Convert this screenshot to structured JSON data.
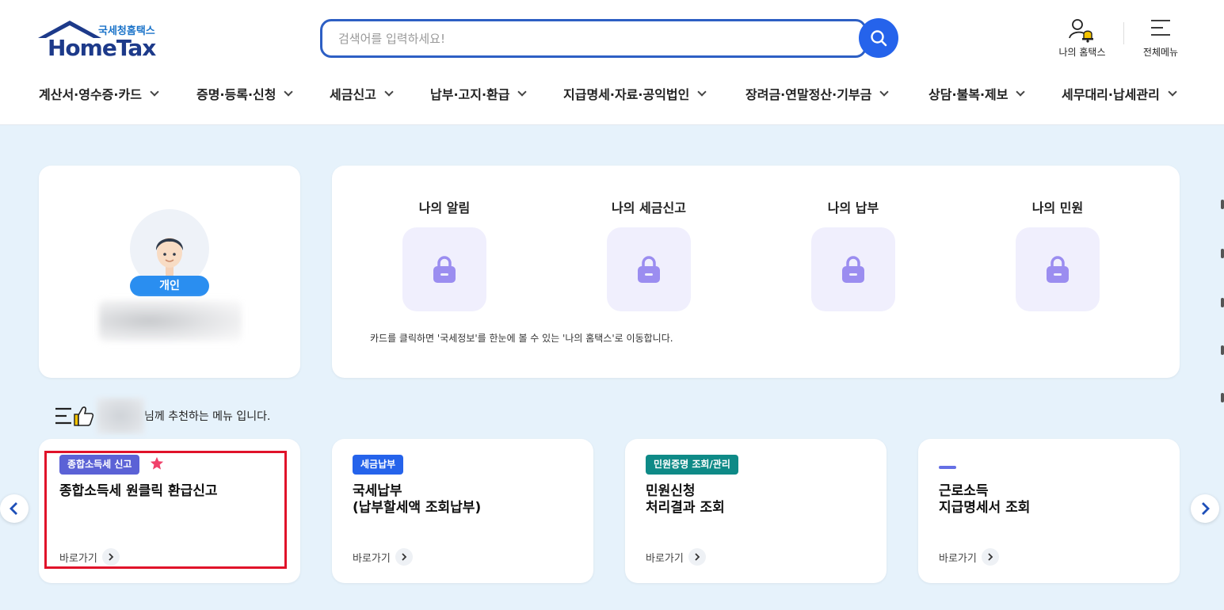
{
  "header": {
    "logo_sub": "국세청홈택스",
    "logo_main": "HomeTax",
    "search_placeholder": "검색어를 입력하세요!",
    "my_hometax": "나의 홈택스",
    "all_menu": "전체메뉴"
  },
  "nav": [
    {
      "label": "계산서·영수증·카드"
    },
    {
      "label": "증명·등록·신청"
    },
    {
      "label": "세금신고"
    },
    {
      "label": "납부·고지·환급"
    },
    {
      "label": "지급명세·자료·공익법인"
    },
    {
      "label": "장려금·연말정산·기부금"
    },
    {
      "label": "상담·불복·제보"
    },
    {
      "label": "세무대리·납세관리"
    }
  ],
  "profile": {
    "type_badge": "개인"
  },
  "summary": {
    "items": [
      {
        "title": "나의 알림"
      },
      {
        "title": "나의 세금신고"
      },
      {
        "title": "나의 납부"
      },
      {
        "title": "나의 민원"
      }
    ],
    "note": "카드를 클릭하면 '국세정보'를 한눈에 볼 수 있는 '나의 홈택스'로 이동합니다."
  },
  "recommend": {
    "suffix": "님께 추천하는 메뉴 입니다."
  },
  "menu_cards": [
    {
      "tag": "종합소득세 신고",
      "tag_color": "#5b62d6",
      "title_line1": "종합소득세 원클릭 환급신고",
      "title_line2": "",
      "goto": "바로가기"
    },
    {
      "tag": "세금납부",
      "tag_color": "#2563eb",
      "title_line1": "국세납부",
      "title_line2": "(납부할세액 조회납부)",
      "goto": "바로가기"
    },
    {
      "tag": "민원증명 조회/관리",
      "tag_color": "#0e8a87",
      "title_line1": "민원신청",
      "title_line2": "처리결과 조회",
      "goto": "바로가기"
    },
    {
      "tag": "",
      "tag_color": "#6570e5",
      "title_line1": "근로소득",
      "title_line2": "지급명세서 조회",
      "goto": "바로가기"
    }
  ],
  "colors": {
    "brand_blue": "#2563eb",
    "background": "#e6f2fb",
    "highlight_red": "#e0132a",
    "lock_purple": "#9b8df0"
  }
}
